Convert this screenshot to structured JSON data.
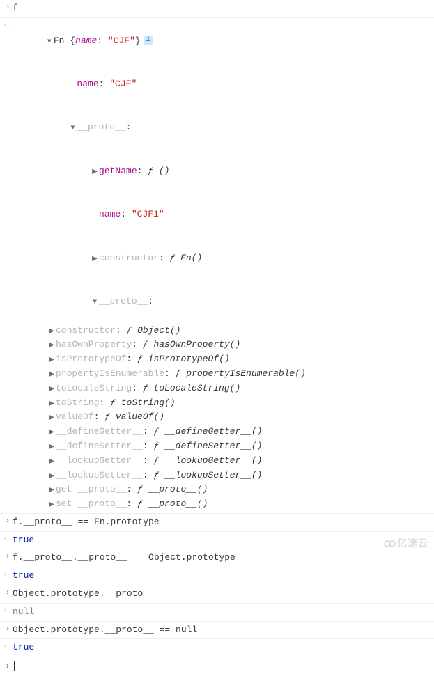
{
  "rows": {
    "input_f": "f",
    "fn_header": {
      "class": "Fn",
      "name_key": "name",
      "name_val": "\"CJF\""
    },
    "name_prop": {
      "key": "name",
      "val": "\"CJF\""
    },
    "proto1": "__proto__",
    "getName": {
      "key": "getName",
      "f": "ƒ",
      "sig": "()"
    },
    "name2": {
      "key": "name",
      "val": "\"CJF1\""
    },
    "constructor1": {
      "key": "constructor",
      "f": "ƒ",
      "sig": "Fn()"
    },
    "proto2": "__proto__",
    "obj_methods": [
      {
        "key": "constructor",
        "f": "ƒ",
        "sig": "Object()"
      },
      {
        "key": "hasOwnProperty",
        "f": "ƒ",
        "sig": "hasOwnProperty()"
      },
      {
        "key": "isPrototypeOf",
        "f": "ƒ",
        "sig": "isPrototypeOf()"
      },
      {
        "key": "propertyIsEnumerable",
        "f": "ƒ",
        "sig": "propertyIsEnumerable()"
      },
      {
        "key": "toLocaleString",
        "f": "ƒ",
        "sig": "toLocaleString()"
      },
      {
        "key": "toString",
        "f": "ƒ",
        "sig": "toString()"
      },
      {
        "key": "valueOf",
        "f": "ƒ",
        "sig": "valueOf()"
      },
      {
        "key": "__defineGetter__",
        "f": "ƒ",
        "sig": "__defineGetter__()"
      },
      {
        "key": "__defineSetter__",
        "f": "ƒ",
        "sig": "__defineSetter__()"
      },
      {
        "key": "__lookupGetter__",
        "f": "ƒ",
        "sig": "__lookupGetter__()"
      },
      {
        "key": "__lookupSetter__",
        "f": "ƒ",
        "sig": "__lookupSetter__()"
      },
      {
        "key": "get __proto__",
        "f": "ƒ",
        "sig": "__proto__()"
      },
      {
        "key": "set __proto__",
        "f": "ƒ",
        "sig": "__proto__()"
      }
    ],
    "expr1": "f.__proto__ == Fn.prototype",
    "res1": "true",
    "expr2": "f.__proto__.__proto__ == Object.prototype",
    "res2": "true",
    "expr3": "Object.prototype.__proto__",
    "res3": "null",
    "expr4": "Object.prototype.__proto__ == null",
    "res4": "true"
  },
  "info_badge": "i",
  "watermark": "亿速云"
}
